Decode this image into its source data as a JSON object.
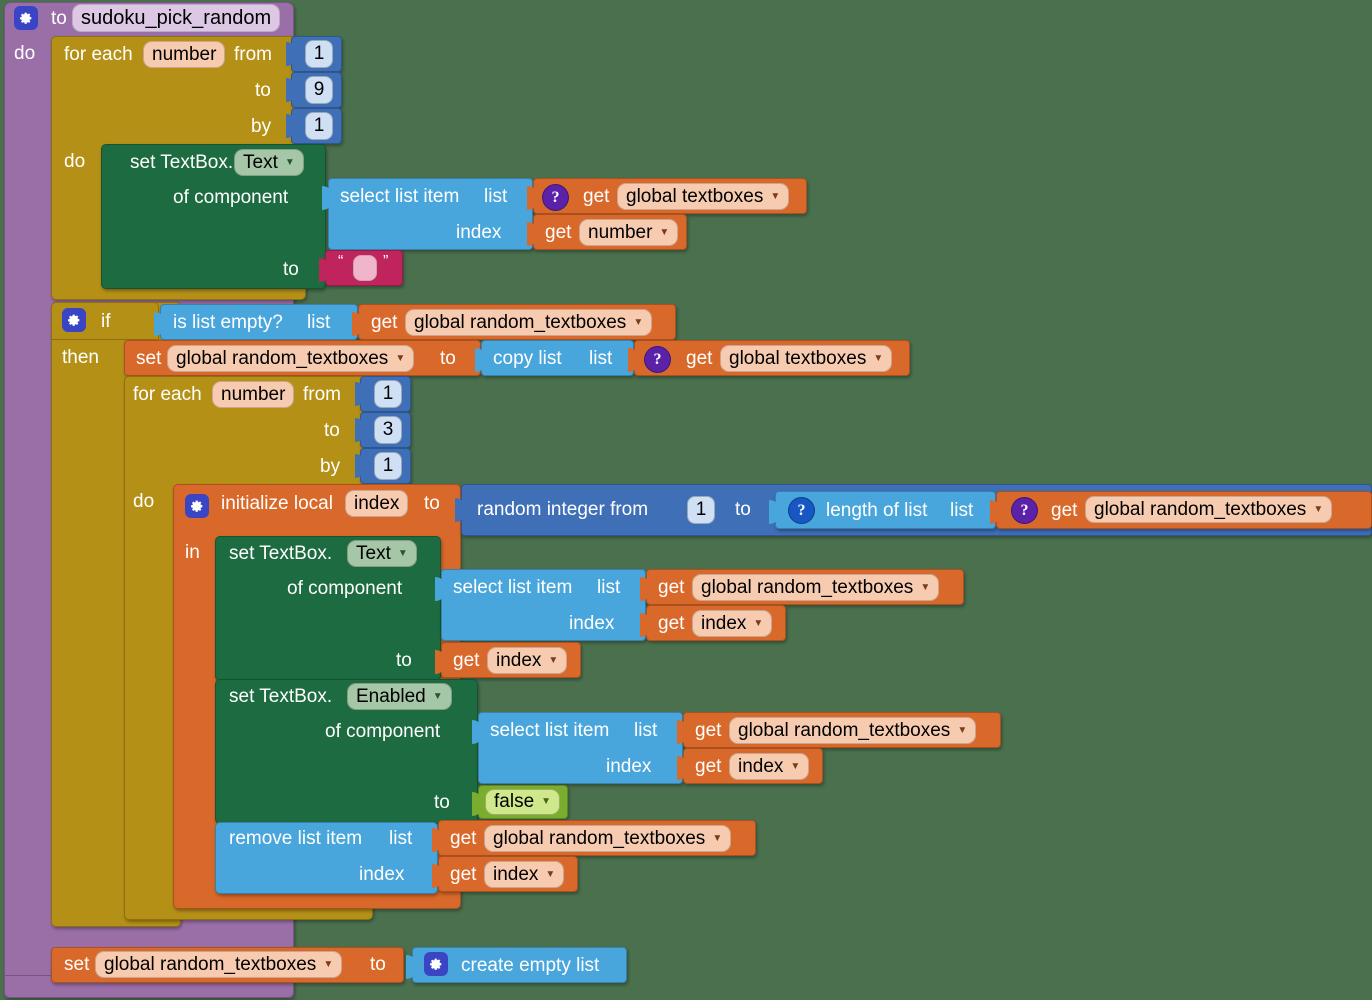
{
  "app": {
    "name": "MIT App Inventor Blocks Editor",
    "canvas_background": "#4a704e"
  },
  "colors": {
    "procedure": "#9a6fa8",
    "control": "#b59017",
    "variables": "#d9692a",
    "lists": "#49a6dc",
    "math": "#3e6fb7",
    "text": "#c0245c",
    "component_setter": "#1d6b40",
    "logic": "#7aac2e",
    "gear_icon": "#3a45c6",
    "badge_purple": "#5b21a8",
    "badge_blue": "#1757c4"
  },
  "procedure": {
    "keyword": "to",
    "name": "sudoku_pick_random",
    "body_label": "do",
    "gear_icon": "gear-icon"
  },
  "loop1": {
    "for_each": "for each",
    "var": "number",
    "from_label": "from",
    "from_value": "1",
    "to_label": "to",
    "to_value": "9",
    "by_label": "by",
    "by_value": "1",
    "do_label": "do"
  },
  "set_textbox_text_1": {
    "set_label": "set TextBox.",
    "property": "Text",
    "of_component_label": "of component",
    "to_label": "to",
    "value_open_quote": "“",
    "value_close_quote": "”",
    "value_text": ""
  },
  "select_list_item_1": {
    "op": "select list item",
    "list_label": "list",
    "index_label": "index",
    "list_get": "global textboxes",
    "index_get": "number",
    "get_label": "get",
    "list_badge": "help-icon"
  },
  "if_block": {
    "gear_icon": "gear-icon",
    "if_label": "if",
    "then_label": "then",
    "condition": {
      "op": "is list empty?",
      "list_label": "list",
      "get_label": "get",
      "variable": "global random_textboxes"
    }
  },
  "set_random_textboxes_copy": {
    "set_label": "set",
    "variable": "global random_textboxes",
    "to_label": "to",
    "value": {
      "op": "copy list",
      "list_label": "list",
      "badge": "help-icon",
      "get_label": "get",
      "variable": "global textboxes",
      "get_badge": "help-icon"
    }
  },
  "loop2": {
    "for_each": "for each",
    "var": "number",
    "from_label": "from",
    "from_value": "1",
    "to_label": "to",
    "to_value": "3",
    "by_label": "by",
    "by_value": "1",
    "do_label": "do"
  },
  "init_local": {
    "gear_icon": "gear-icon",
    "keyword": "initialize local",
    "var": "index",
    "to_label": "to",
    "in_label": "in",
    "value": {
      "op": "random integer from",
      "from_value": "1",
      "to_label": "to",
      "length_op": "length of list",
      "length_list_label": "list",
      "length_badge": "help-icon",
      "get_label": "get",
      "variable": "global random_textboxes",
      "get_badge": "help-icon"
    }
  },
  "set_textbox_text_2": {
    "set_label": "set TextBox.",
    "property": "Text",
    "of_component_label": "of component",
    "to_label": "to",
    "select": {
      "op": "select list item",
      "list_label": "list",
      "index_label": "index",
      "get_label": "get",
      "list_variable": "global random_textboxes",
      "index_variable": "index"
    },
    "value_get_label": "get",
    "value_variable": "index"
  },
  "set_textbox_enabled": {
    "set_label": "set TextBox.",
    "property": "Enabled",
    "of_component_label": "of component",
    "to_label": "to",
    "select": {
      "op": "select list item",
      "list_label": "list",
      "index_label": "index",
      "get_label": "get",
      "list_variable": "global random_textboxes",
      "index_variable": "index"
    },
    "value": "false"
  },
  "remove_list_item": {
    "op": "remove list item",
    "list_label": "list",
    "index_label": "index",
    "get_label": "get",
    "list_variable": "global random_textboxes",
    "index_variable": "index"
  },
  "set_random_textboxes_empty": {
    "set_label": "set",
    "variable": "global random_textboxes",
    "to_label": "to",
    "value": {
      "gear_icon": "gear-icon",
      "op": "create empty list"
    }
  }
}
